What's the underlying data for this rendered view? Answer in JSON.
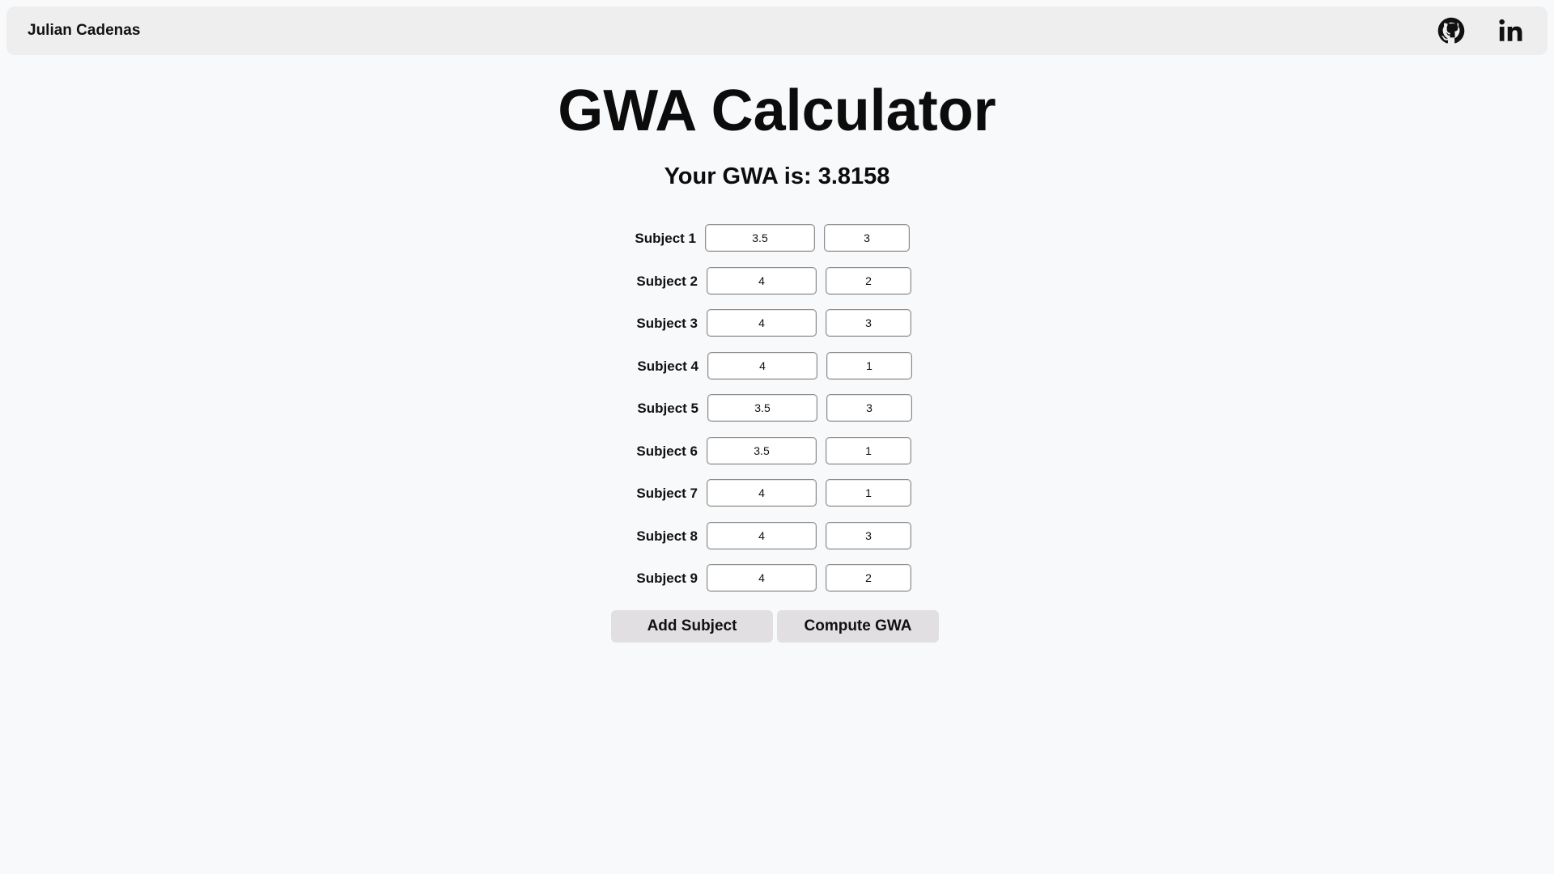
{
  "navbar": {
    "brand": "Julian Cadenas",
    "icons": [
      "github-icon",
      "linkedin-icon"
    ]
  },
  "title": "GWA Calculator",
  "result": {
    "label": "Your GWA is:",
    "value": "3.8158"
  },
  "subjects": [
    {
      "label": "Subject 1",
      "grade": "3.5",
      "units": "3"
    },
    {
      "label": "Subject 2",
      "grade": "4",
      "units": "2"
    },
    {
      "label": "Subject 3",
      "grade": "4",
      "units": "3"
    },
    {
      "label": "Subject 4",
      "grade": "4",
      "units": "1"
    },
    {
      "label": "Subject 5",
      "grade": "3.5",
      "units": "3"
    },
    {
      "label": "Subject 6",
      "grade": "3.5",
      "units": "1"
    },
    {
      "label": "Subject 7",
      "grade": "4",
      "units": "1"
    },
    {
      "label": "Subject 8",
      "grade": "4",
      "units": "3"
    },
    {
      "label": "Subject 9",
      "grade": "4",
      "units": "2"
    }
  ],
  "buttons": {
    "add": "Add Subject",
    "compute": "Compute GWA"
  },
  "colors": {
    "background": "#f8f9fa",
    "navbar": "#eeeeee",
    "button": "#e2dfe2",
    "text": "#111111"
  }
}
